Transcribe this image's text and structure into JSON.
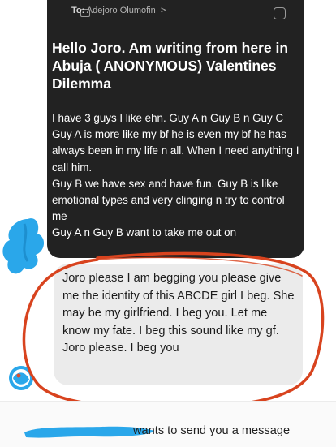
{
  "conversation": {
    "recipient_prefix": "To:",
    "recipient_name": "Adejoro Olumofin",
    "recipient_chevron": ">",
    "icons": [
      "message-icon",
      "compose-icon"
    ]
  },
  "received_message": {
    "heading": "Hello Joro. Am writing from here in Abuja ( ANONYMOUS) Valentines Dilemma",
    "paragraphs": [
      "I have 3 guys I like ehn. Guy A n Guy B n Guy C",
      "Guy A is more like my bf he is even my bf he has always been in my life n all. When I need anything I call him.",
      "Guy B we have sex and have fun. Guy B is like emotional types and very clinging n try to control me",
      "Guy A n Guy B want to take me out on"
    ]
  },
  "reply_message": {
    "text": "Joro please I am begging you please give me the identity of this ABCDE girl I beg. She may be my girlfriend. I beg you. Let me know my fate. I beg this sound like my gf. Joro please. I beg you"
  },
  "footer": {
    "request_text": "wants to send you a message"
  },
  "colors": {
    "dark_card": "#222222",
    "reply_bubble": "#ebebeb",
    "annotation_red": "#d8431e",
    "redaction_blue": "#2aa7ea"
  }
}
